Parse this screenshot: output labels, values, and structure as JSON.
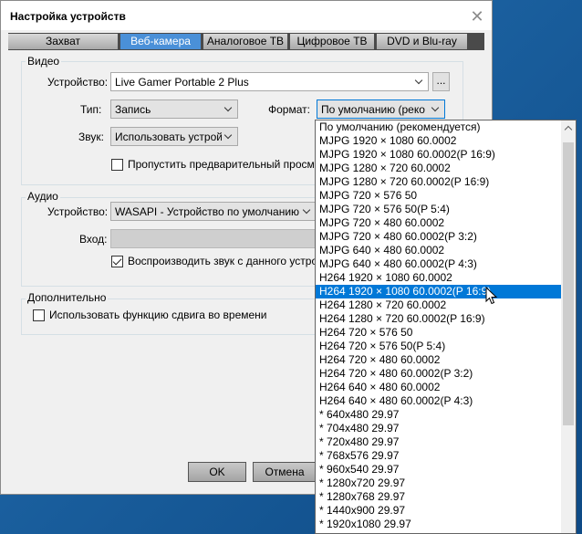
{
  "window": {
    "title": "Настройка устройств"
  },
  "tabs": [
    {
      "label": "Захват",
      "active": false
    },
    {
      "label": "Веб-камера",
      "active": true
    },
    {
      "label": "Аналоговое ТВ",
      "active": false
    },
    {
      "label": "Цифровое ТВ",
      "active": false
    },
    {
      "label": "DVD и Blu-ray",
      "active": false
    }
  ],
  "video": {
    "title": "Видео",
    "device_label": "Устройство:",
    "device_value": "Live Gamer Portable 2 Plus",
    "browse_label": "...",
    "type_label": "Тип:",
    "type_value": "Запись",
    "format_label": "Формат:",
    "format_value": "По умолчанию (реко",
    "sound_label": "Звук:",
    "sound_value": "Использовать устрой",
    "skip_preview_label": "Пропустить предварительный просмо",
    "skip_preview_checked": false
  },
  "audio": {
    "title": "Аудио",
    "device_label": "Устройство:",
    "device_value": "WASAPI - Устройство по умолчанию",
    "input_label": "Вход:",
    "play_sound_label": "Воспроизводить звук с данного устрой",
    "play_sound_checked": true
  },
  "advanced": {
    "title": "Дополнительно",
    "timeshift_label": "Использовать функцию сдвига во времени",
    "timeshift_checked": false
  },
  "buttons": {
    "ok": "OK",
    "cancel": "Отмена"
  },
  "format_options": [
    "По умолчанию (рекомендуется)",
    "MJPG 1920 × 1080 60.0002",
    "MJPG 1920 × 1080 60.0002(P 16:9)",
    "MJPG 1280 × 720 60.0002",
    "MJPG 1280 × 720 60.0002(P 16:9)",
    "MJPG 720 × 576 50",
    "MJPG 720 × 576 50(P 5:4)",
    "MJPG 720 × 480 60.0002",
    "MJPG 720 × 480 60.0002(P 3:2)",
    "MJPG 640 × 480 60.0002",
    "MJPG 640 × 480 60.0002(P 4:3)",
    "H264 1920 × 1080 60.0002",
    "H264 1920 × 1080 60.0002(P 16:9)",
    "H264 1280 × 720 60.0002",
    "H264 1280 × 720 60.0002(P 16:9)",
    "H264 720 × 576 50",
    "H264 720 × 576 50(P 5:4)",
    "H264 720 × 480 60.0002",
    "H264 720 × 480 60.0002(P 3:2)",
    "H264 640 × 480 60.0002",
    "H264 640 × 480 60.0002(P 4:3)",
    "* 640x480 29.97",
    "* 704x480 29.97",
    "* 720x480 29.97",
    "* 768x576 29.97",
    "* 960x540 29.97",
    "* 1280x720 29.97",
    "* 1280x768 29.97",
    "* 1440x900 29.97",
    "* 1920x1080 29.97"
  ],
  "format_selected_index": 12,
  "colors": {
    "accent": "#0078d7",
    "active_tab": "#4a90d8",
    "desktop": "#1f6fb0"
  },
  "icons": {
    "close": "close-icon",
    "cursor": "mouse-pointer-icon"
  }
}
